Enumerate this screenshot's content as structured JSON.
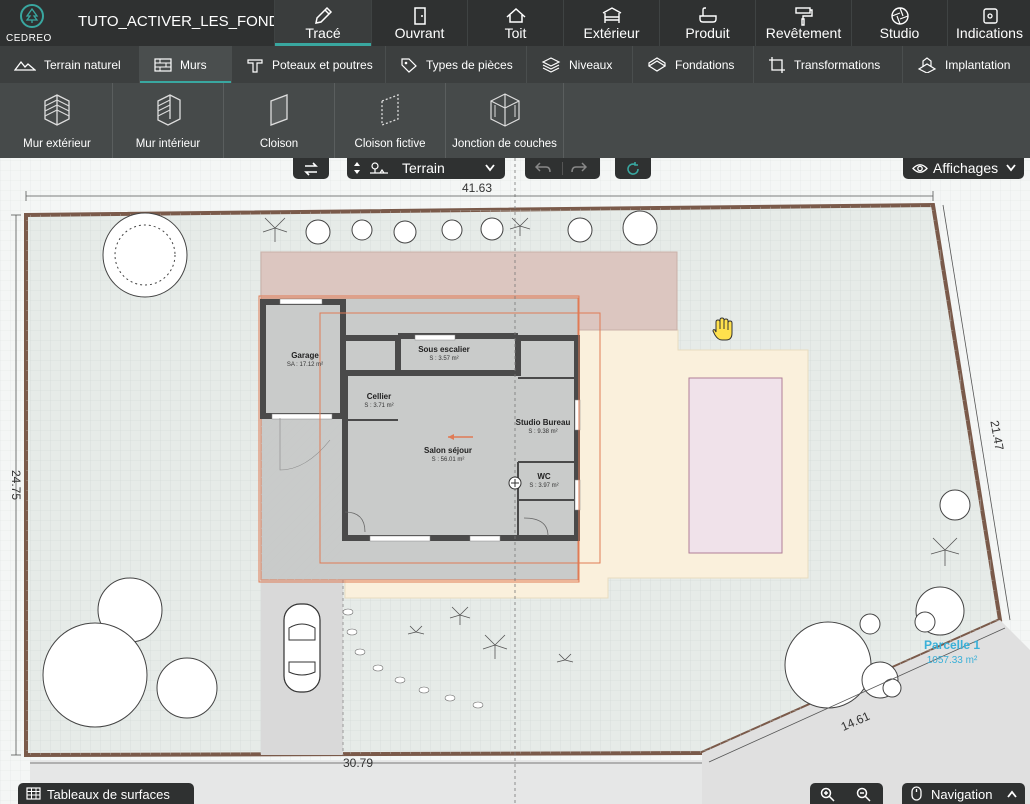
{
  "app": {
    "brand": "CEDREO",
    "project_name": "TUTO_ACTIVER_LES_FONDA..."
  },
  "main_tabs": [
    {
      "label": "Tracé",
      "icon": "pencil-icon",
      "active": true
    },
    {
      "label": "Ouvrant",
      "icon": "door-icon"
    },
    {
      "label": "Toit",
      "icon": "roof-icon"
    },
    {
      "label": "Extérieur",
      "icon": "pergola-icon"
    },
    {
      "label": "Produit",
      "icon": "bathtub-icon"
    },
    {
      "label": "Revêtement",
      "icon": "paint-roller-icon"
    },
    {
      "label": "Studio",
      "icon": "camera-aperture-icon"
    },
    {
      "label": "Indications",
      "icon": "tag-icon"
    }
  ],
  "sub_tabs": [
    {
      "label": "Terrain naturel",
      "icon": "terrain-icon"
    },
    {
      "label": "Murs",
      "icon": "brick-wall-icon",
      "active": true
    },
    {
      "label": "Poteaux et poutres",
      "icon": "beam-icon"
    },
    {
      "label": "Types de pièces",
      "icon": "room-tag-icon"
    },
    {
      "label": "Niveaux",
      "icon": "layers-icon"
    },
    {
      "label": "Fondations",
      "icon": "foundation-icon"
    },
    {
      "label": "Transformations",
      "icon": "crop-icon"
    },
    {
      "label": "Implantation",
      "icon": "implantation-icon"
    }
  ],
  "tools": [
    {
      "label": "Mur extérieur",
      "icon": "exterior-wall-icon"
    },
    {
      "label": "Mur intérieur",
      "icon": "interior-wall-icon"
    },
    {
      "label": "Cloison",
      "icon": "partition-icon"
    },
    {
      "label": "Cloison fictive",
      "icon": "fictive-partition-icon"
    },
    {
      "label": "Jonction de couches",
      "icon": "layer-junction-icon"
    }
  ],
  "view_controls": {
    "swap_icon": "swap-arrows-icon",
    "level_label": "Terrain",
    "affichages_label": "Affichages",
    "undo_icon": "undo-icon",
    "redo_icon": "redo-icon",
    "sync_icon": "sync-icon"
  },
  "plan": {
    "dimensions": {
      "top": "41.63",
      "left": "24.75",
      "right": "21.47",
      "bottom_left": "30.79",
      "bottom_right": "14.61"
    },
    "rooms": [
      {
        "name": "Garage",
        "area": "SA : 17.12 m²"
      },
      {
        "name": "Sous escalier",
        "area": "S : 3.57 m²"
      },
      {
        "name": "Cellier",
        "area": "S : 3.71 m²"
      },
      {
        "name": "Salon séjour",
        "area": "S : 56.01 m²"
      },
      {
        "name": "Studio Bureau",
        "area": "S : 9.38 m²"
      },
      {
        "name": "WC",
        "area": "S : 3.97 m²"
      }
    ],
    "parcel": {
      "name": "Parcelle 1",
      "area": "1057.33 m²"
    },
    "colors": {
      "parcel_text": "#3ab0d8",
      "wall": "#4a4a4a",
      "plot_border": "#7a5a4a",
      "terrace": "#faf0dc",
      "pool": "#f0e2ea",
      "orange_line": "#e07b55"
    }
  },
  "bottom": {
    "tables_label": "Tableaux de surfaces",
    "tables_icon": "table-icon",
    "zoom_in_icon": "zoom-in-icon",
    "zoom_out_icon": "zoom-out-icon",
    "navigation_label": "Navigation",
    "navigation_icon": "mouse-icon"
  }
}
